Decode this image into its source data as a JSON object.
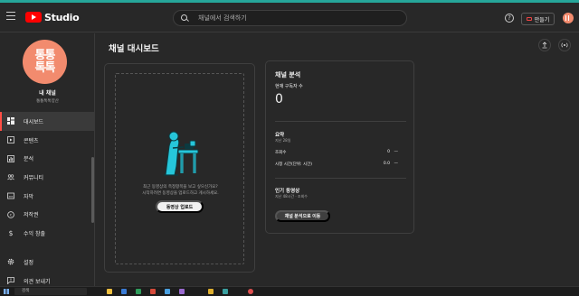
{
  "header": {
    "logo_text": "Studio",
    "search_placeholder": "채널에서 검색하기",
    "help_icon": "?",
    "create_label": "만들기"
  },
  "sidebar": {
    "avatar_line1": "통통",
    "avatar_line2": "톡톡",
    "channel_name": "내 채널",
    "channel_handle": "통통톡톡양산",
    "items": [
      {
        "label": "대시보드",
        "icon": "dashboard-icon",
        "active": true
      },
      {
        "label": "콘텐츠",
        "icon": "content-icon"
      },
      {
        "label": "분석",
        "icon": "analytics-icon"
      },
      {
        "label": "커뮤니티",
        "icon": "community-icon"
      },
      {
        "label": "자막",
        "icon": "subtitles-icon"
      },
      {
        "label": "저작권",
        "icon": "copyright-icon"
      },
      {
        "label": "수익 창출",
        "icon": "monetization-icon"
      }
    ],
    "lower_items": [
      {
        "label": "설정",
        "icon": "gear-icon"
      },
      {
        "label": "의견 보내기",
        "icon": "feedback-icon"
      }
    ]
  },
  "main": {
    "title": "채널 대시보드",
    "upload_prompt_line1": "최근 동영상의 측정항목을 보고 싶으신가요?",
    "upload_prompt_line2": "시작하려면 동영상을 업로드하고 게시하세요.",
    "upload_button": "동영상 업로드"
  },
  "analytics": {
    "title": "채널 분석",
    "subscribers_label": "현재 구독자 수",
    "subscribers_value": "0",
    "summary_title": "요약",
    "summary_period": "지난 28일",
    "views_label": "조회수",
    "views_value": "0",
    "views_trend": "—",
    "watch_label": "시청 시간(단위: 시간)",
    "watch_value": "0.0",
    "watch_trend": "—",
    "top_videos_title": "인기 동영상",
    "top_videos_note": "지난 48시간 · 조회수",
    "go_button": "채널 분석으로 이동"
  },
  "taskbar": {
    "search_placeholder": "검색"
  },
  "colors": {
    "background": "#282828",
    "accent_red": "#ff0000",
    "avatar": "#f28b6e",
    "illustration": "#26c6da"
  }
}
